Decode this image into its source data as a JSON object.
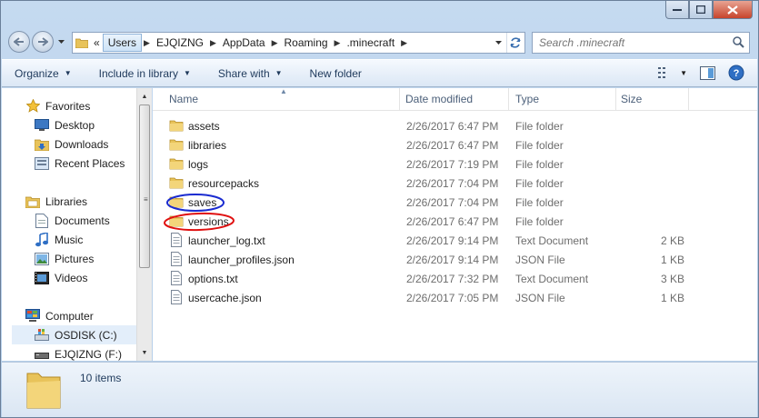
{
  "address": {
    "overflow": "«",
    "crumbs": [
      "Users",
      "EJQIZNG",
      "AppData",
      "Roaming",
      ".minecraft"
    ]
  },
  "search": {
    "placeholder": "Search .minecraft"
  },
  "toolbar": {
    "organize": "Organize",
    "include_in_library": "Include in library",
    "share_with": "Share with",
    "new_folder": "New folder"
  },
  "nav": {
    "favorites": "Favorites",
    "desktop": "Desktop",
    "downloads": "Downloads",
    "recent_places": "Recent Places",
    "libraries": "Libraries",
    "documents": "Documents",
    "music": "Music",
    "pictures": "Pictures",
    "videos": "Videos",
    "computer": "Computer",
    "osdisk": "OSDISK (C:)",
    "ejqizng": "EJQIZNG (F:)"
  },
  "columns": {
    "name": "Name",
    "date": "Date modified",
    "type": "Type",
    "size": "Size"
  },
  "files": [
    {
      "name": "assets",
      "date": "2/26/2017 6:47 PM",
      "type": "File folder",
      "size": "",
      "icon": "folder-icon"
    },
    {
      "name": "libraries",
      "date": "2/26/2017 6:47 PM",
      "type": "File folder",
      "size": "",
      "icon": "folder-icon"
    },
    {
      "name": "logs",
      "date": "2/26/2017 7:19 PM",
      "type": "File folder",
      "size": "",
      "icon": "folder-icon"
    },
    {
      "name": "resourcepacks",
      "date": "2/26/2017 7:04 PM",
      "type": "File folder",
      "size": "",
      "icon": "folder-icon"
    },
    {
      "name": "saves",
      "date": "2/26/2017 7:04 PM",
      "type": "File folder",
      "size": "",
      "icon": "folder-icon"
    },
    {
      "name": "versions",
      "date": "2/26/2017 6:47 PM",
      "type": "File folder",
      "size": "",
      "icon": "folder-icon"
    },
    {
      "name": "launcher_log.txt",
      "date": "2/26/2017 9:14 PM",
      "type": "Text Document",
      "size": "2 KB",
      "icon": "document-icon"
    },
    {
      "name": "launcher_profiles.json",
      "date": "2/26/2017 9:14 PM",
      "type": "JSON File",
      "size": "1 KB",
      "icon": "document-icon"
    },
    {
      "name": "options.txt",
      "date": "2/26/2017 7:32 PM",
      "type": "Text Document",
      "size": "3 KB",
      "icon": "document-icon"
    },
    {
      "name": "usercache.json",
      "date": "2/26/2017 7:05 PM",
      "type": "JSON File",
      "size": "1 KB",
      "icon": "document-icon"
    }
  ],
  "status": {
    "count": "10 items"
  },
  "colors": {
    "annotation_blue": "#1a2bd0",
    "annotation_red": "#e01010",
    "folder": "#e8c35a"
  }
}
